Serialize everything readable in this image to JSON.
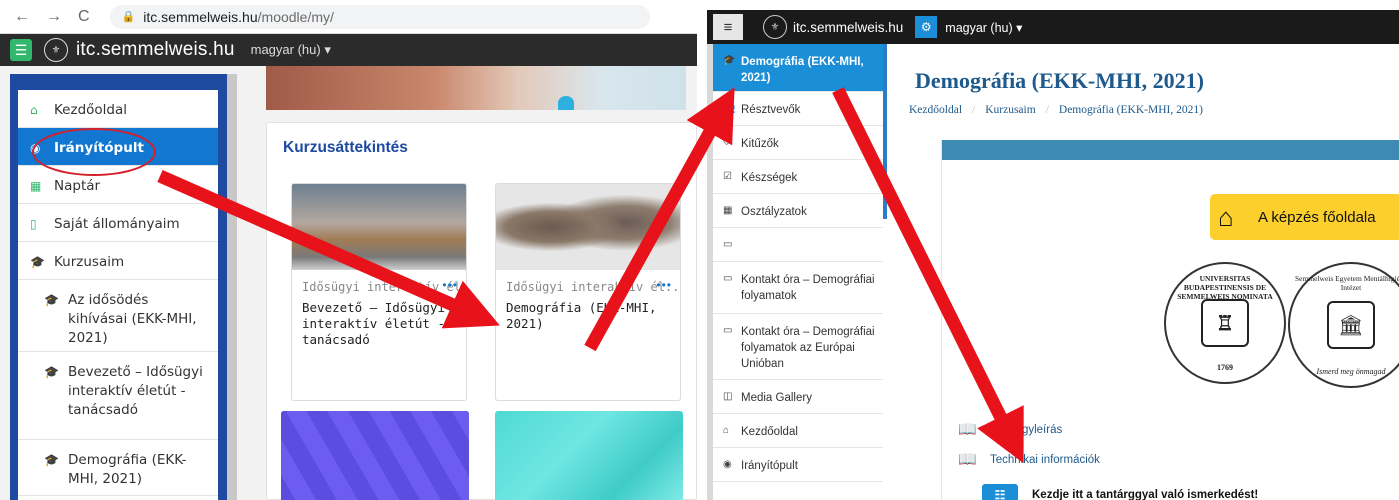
{
  "left": {
    "browser": {
      "url_host": "itc.semmelweis.hu",
      "url_path": "/moodle/my/"
    },
    "topbar": {
      "site_name": "itc.semmelweis.hu",
      "language": "magyar (hu)"
    },
    "drawer": {
      "items": [
        {
          "label": "Kezdőoldal",
          "icon": "home-icon"
        },
        {
          "label": "Irányítópult",
          "icon": "dashboard-icon",
          "active": true
        },
        {
          "label": "Naptár",
          "icon": "calendar-icon"
        },
        {
          "label": "Saját állományaim",
          "icon": "file-icon"
        },
        {
          "label": "Kurzusaim",
          "icon": "graduation-cap-icon"
        },
        {
          "label": "Az idősödés kihívásai (EKK-MHI, 2021)",
          "icon": "graduation-cap-icon"
        },
        {
          "label": "Bevezető – Idősügyi interaktív életút - tanácsadó",
          "icon": "graduation-cap-icon"
        },
        {
          "label": "Demográfia (EKK-MHI, 2021)",
          "icon": "graduation-cap-icon"
        }
      ]
    },
    "overview": {
      "title": "Kurzusáttekintés",
      "courses": [
        {
          "category": "Idősügyi interaktív él...",
          "name": "Bevezető – Idősügyi interaktív életút - tanácsadó"
        },
        {
          "category": "Idősügyi interaktív él...",
          "name": "Demográfia (EKK-MHI, 2021)"
        }
      ],
      "more_label": "•••"
    }
  },
  "right": {
    "topbar": {
      "site_name": "itc.semmelweis.hu",
      "language": "magyar (hu)"
    },
    "drawer": {
      "items": [
        {
          "label": "Demográfia (EKK-MHI, 2021)",
          "icon": "graduation-cap-icon",
          "active": true
        },
        {
          "label": "Résztvevők",
          "icon": "users-icon"
        },
        {
          "label": "Kitűzők",
          "icon": "badge-icon"
        },
        {
          "label": "Készségek",
          "icon": "check-square-icon"
        },
        {
          "label": "Osztályzatok",
          "icon": "table-icon"
        },
        {
          "label": "",
          "icon": "folder-icon"
        },
        {
          "label": "Kontakt óra – Demográfiai folyamatok",
          "icon": "folder-icon"
        },
        {
          "label": "Kontakt óra – Demográfiai folyamatok az Európai Unióban",
          "icon": "folder-icon"
        },
        {
          "label": "Media Gallery",
          "icon": "gallery-icon"
        },
        {
          "label": "Kezdőoldal",
          "icon": "home-icon"
        },
        {
          "label": "Irányítópult",
          "icon": "dashboard-icon"
        }
      ]
    },
    "page": {
      "title": "Demográfia (EKK-MHI, 2021)",
      "breadcrumb": [
        "Kezdőoldal",
        "Kurzusaim",
        "Demográfia (EKK-MHI, 2021)"
      ],
      "home_button": "A képzés főoldala",
      "seal_university_top": "UNIVERSITAS BUDAPESTINENSIS DE SEMMELWEIS NOMINATA",
      "seal_university_year": "1769",
      "seal_institute_top": "Semmelweis Egyetem Mentálhigiéné Intézet",
      "seal_institute_bottom": "Ismerd meg önmagad",
      "links": [
        "Tantárgyleírás",
        "Technikai információk"
      ],
      "intro_note": "Kezdje itt a tantárggyal való ismerkedést!"
    }
  }
}
